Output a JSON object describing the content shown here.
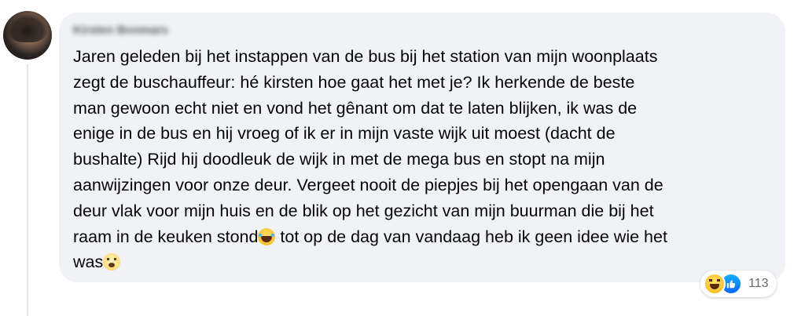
{
  "comment": {
    "author": "Kirsten Boomars",
    "lines": [
      "Jaren geleden bij het instappen van de bus bij het station van mijn woonplaats",
      "zegt de buschauffeur: hé kirsten hoe gaat het met je? Ik herkende de beste",
      "man gewoon echt niet en vond het gênant om dat te laten blijken, ik was de",
      "enige in de bus en hij vroeg of ik er in mijn vaste wijk uit moest (dacht de",
      "bushalte) Rijd hij doodleuk de wijk in met de mega bus en stopt na mijn",
      "aanwijzingen voor onze deur. Vergeet nooit de piepjes bij het opengaan van de",
      "deur vlak voor mijn huis en de blik op het gezicht van mijn buurman die bij het",
      "raam in de keuken stond",
      " tot op de dag van vandaag heb ik geen idee wie het",
      "was"
    ],
    "inline_emojis": [
      "laughing-tears-emoji",
      "cold-face-emoji"
    ]
  },
  "reactions": {
    "icons": [
      "haha-reaction-icon",
      "like-reaction-icon"
    ],
    "count": "113",
    "colors": {
      "like": "#0866ff",
      "haha": "#fbc531",
      "count_text": "#65676b"
    }
  },
  "colors": {
    "bubble": "#f0f2f5",
    "text": "#050505",
    "thread_line": "#e4e6eb"
  }
}
